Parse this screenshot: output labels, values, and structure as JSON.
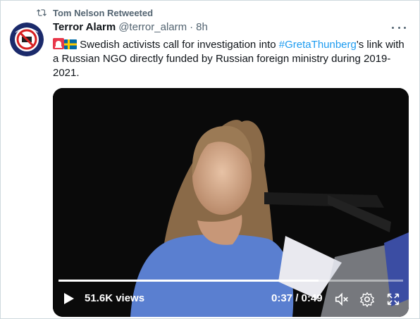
{
  "retweet": {
    "icon": "retweet-icon",
    "text": "Tom Nelson Retweeted"
  },
  "tweet": {
    "author": {
      "name": "Terror Alarm",
      "handle": "@terror_alarm",
      "avatar_icon": "terror-alarm-logo"
    },
    "separator": "·",
    "time": "8h",
    "text_part1": " Swedish activists call for investigation into ",
    "hashtag": "#GretaThunberg",
    "text_part2": "'s  link with a Russian NGO directly funded by Russian foreign ministry during 2019-2021.",
    "emojis": [
      "alarm-light-icon",
      "sweden-flag-icon"
    ],
    "link_color": "#1d9bf0"
  },
  "video": {
    "views": "51.6K views",
    "time": "0:37 / 0:49",
    "progress": 0.755,
    "icons": [
      "play-icon",
      "mute-icon",
      "settings-icon",
      "fullscreen-icon"
    ]
  }
}
